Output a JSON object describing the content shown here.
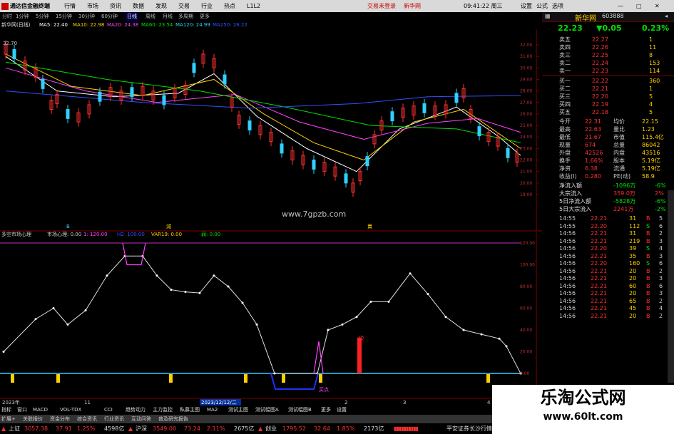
{
  "menubar": {
    "app_name": "通达信金融终端",
    "items": [
      "行情",
      "市场",
      "资讯",
      "数据",
      "发现",
      "交易",
      "行业",
      "热点",
      "L1L2"
    ],
    "center_links": [
      "交易未登录",
      "新华网"
    ],
    "time": "09:41:22 周三",
    "right_items": [
      "设置",
      "公式",
      "选项"
    ]
  },
  "toolbar": {
    "items": [
      "分时",
      "1分钟",
      "5分钟",
      "15分钟",
      "30分钟",
      "60分钟",
      "日线",
      "周线",
      "月线",
      "多周期",
      "更多"
    ],
    "active": "日线"
  },
  "main_legend": {
    "title": "新华网(日线)",
    "ma": [
      {
        "label": "MA5: 22.40",
        "color": "#ffffff"
      },
      {
        "label": "MA10: 22.98",
        "color": "#ffd000"
      },
      {
        "label": "MA20: 24.38",
        "color": "#ff40ff"
      },
      {
        "label": "MA60: 23.54",
        "color": "#00e000"
      },
      {
        "label": "MA120: 24.99",
        "color": "#30d0ff"
      },
      {
        "label": "MA250: 26.22",
        "color": "#3050ff"
      }
    ],
    "high_mark": "32.70"
  },
  "price_axis": [
    "32.00",
    "31.00",
    "30.00",
    "29.00",
    "28.00",
    "27.00",
    "26.00",
    "25.00",
    "24.00",
    "23.00",
    "22.00",
    "21.00",
    "20.00",
    "19.00"
  ],
  "watermark_main": "www.7gpzb.com",
  "markers": {
    "b_top": "B",
    "yellow_label": "減",
    "bottom_label": "賣"
  },
  "sub_legend": {
    "title": "多空市场心理",
    "name": "市场心理: 0.00",
    "items": [
      {
        "label": "1: 120.00",
        "color": "#ff40ff"
      },
      {
        "label": "H2: 100.00",
        "color": "#3050ff"
      },
      {
        "label": "VAR19: 0.00",
        "color": "#ffd000"
      },
      {
        "label": "弱: 0.00",
        "color": "#00e000"
      }
    ]
  },
  "sub_axis": [
    "120.00",
    "100.00",
    "80.00",
    "60.00",
    "40.00",
    "20.00",
    "0.00"
  ],
  "sub_labels": {
    "buy_point": "买点",
    "top": "顶"
  },
  "date_axis": {
    "left": "2023年",
    "mid": "11",
    "cursor": "2023/12/12/二",
    "marks": [
      "2",
      "3",
      "4"
    ]
  },
  "right_panel": {
    "title": "新华网",
    "code": "603888",
    "price": "22.23",
    "change": "▼0.05",
    "pct": "0.23%",
    "asks": [
      {
        "label": "卖五",
        "price": "22.27",
        "vol": "1"
      },
      {
        "label": "卖四",
        "price": "22.26",
        "vol": "11"
      },
      {
        "label": "卖三",
        "price": "22.25",
        "vol": "8"
      },
      {
        "label": "卖二",
        "price": "22.24",
        "vol": "153"
      },
      {
        "label": "卖一",
        "price": "22.23",
        "vol": "114"
      }
    ],
    "bids": [
      {
        "label": "买一",
        "price": "22.22",
        "vol": "360"
      },
      {
        "label": "买二",
        "price": "22.21",
        "vol": "1"
      },
      {
        "label": "买三",
        "price": "22.20",
        "vol": "5"
      },
      {
        "label": "买四",
        "price": "22.19",
        "vol": "4"
      },
      {
        "label": "买五",
        "price": "22.18",
        "vol": "5"
      }
    ],
    "stats": [
      [
        "今开",
        "22.31",
        "均价",
        "22.15"
      ],
      [
        "最高",
        "22.63",
        "量比",
        "1.23"
      ],
      [
        "最低",
        "21.67",
        "市值",
        "115.4亿"
      ],
      [
        "现量",
        "674",
        "总量",
        "86042"
      ],
      [
        "外盘",
        "42526",
        "内盘",
        "43516"
      ],
      [
        "换手",
        "1.66%",
        "股本",
        "5.19亿"
      ],
      [
        "净资",
        "6.38",
        "流通",
        "5.19亿"
      ],
      [
        "收益(I)",
        "0.280",
        "PE(动)",
        "58.9"
      ]
    ],
    "flows": [
      {
        "label": "净流入额",
        "value": "-1096万",
        "pct": "-6%"
      },
      {
        "label": "大宗流入",
        "value": "359.0万",
        "pct": "2%"
      },
      {
        "label": "5日净流入额",
        "value": "-5828万",
        "pct": "-6%"
      },
      {
        "label": "5日大宗流入",
        "value": "2241万",
        "pct": "-2%"
      }
    ],
    "ticks": [
      [
        "14:55",
        "22.21",
        "31",
        "B",
        "5"
      ],
      [
        "14:55",
        "22.20",
        "112",
        "S",
        "6"
      ],
      [
        "14:56",
        "22.21",
        "31",
        "B",
        "2"
      ],
      [
        "14:56",
        "22.21",
        "219",
        "B",
        "3"
      ],
      [
        "14:56",
        "22.20",
        "39",
        "S",
        "4"
      ],
      [
        "14:56",
        "22.21",
        "35",
        "B",
        "3"
      ],
      [
        "14:56",
        "22.20",
        "160",
        "S",
        "6"
      ],
      [
        "14:56",
        "22.21",
        "20",
        "B",
        "2"
      ],
      [
        "14:56",
        "22.21",
        "20",
        "B",
        "3"
      ],
      [
        "14:56",
        "22.21",
        "60",
        "B",
        "6"
      ],
      [
        "14:56",
        "22.21",
        "20",
        "B",
        "3"
      ],
      [
        "14:56",
        "22.21",
        "65",
        "B",
        "2"
      ],
      [
        "14:56",
        "22.21",
        "45",
        "B",
        "4"
      ],
      [
        "14:56",
        "22.21",
        "20",
        "B",
        "2"
      ]
    ]
  },
  "tabs1": [
    "指标",
    "窗口",
    "MACD",
    "VOL-TDX",
    "CCI",
    "趋势动力",
    "主力监控",
    "私募主图",
    "MA2",
    "测试主图",
    "测试幅图A",
    "测试幅图B",
    "更多",
    "设置"
  ],
  "tabs2": [
    "扩展+",
    "关联报价",
    "资金分布",
    "综合资讯",
    "行业资讯",
    "互动问答",
    "普及研究报告"
  ],
  "status": [
    {
      "name": "上证",
      "val": "3057.38",
      "chg": "37.91",
      "pct": "1.25%",
      "amt": "4598亿"
    },
    {
      "name": "沪深",
      "val": "3549.00",
      "chg": "73.24",
      "pct": "2.11%",
      "amt": "2675亿"
    },
    {
      "name": "创业",
      "val": "1795.52",
      "chg": "32.64",
      "pct": "1.85%",
      "amt": "2173亿"
    }
  ],
  "status_right": "平安证券长沙行情",
  "corner_watermark": {
    "title": "乐淘公式网",
    "url": "www.60lt.com"
  }
}
